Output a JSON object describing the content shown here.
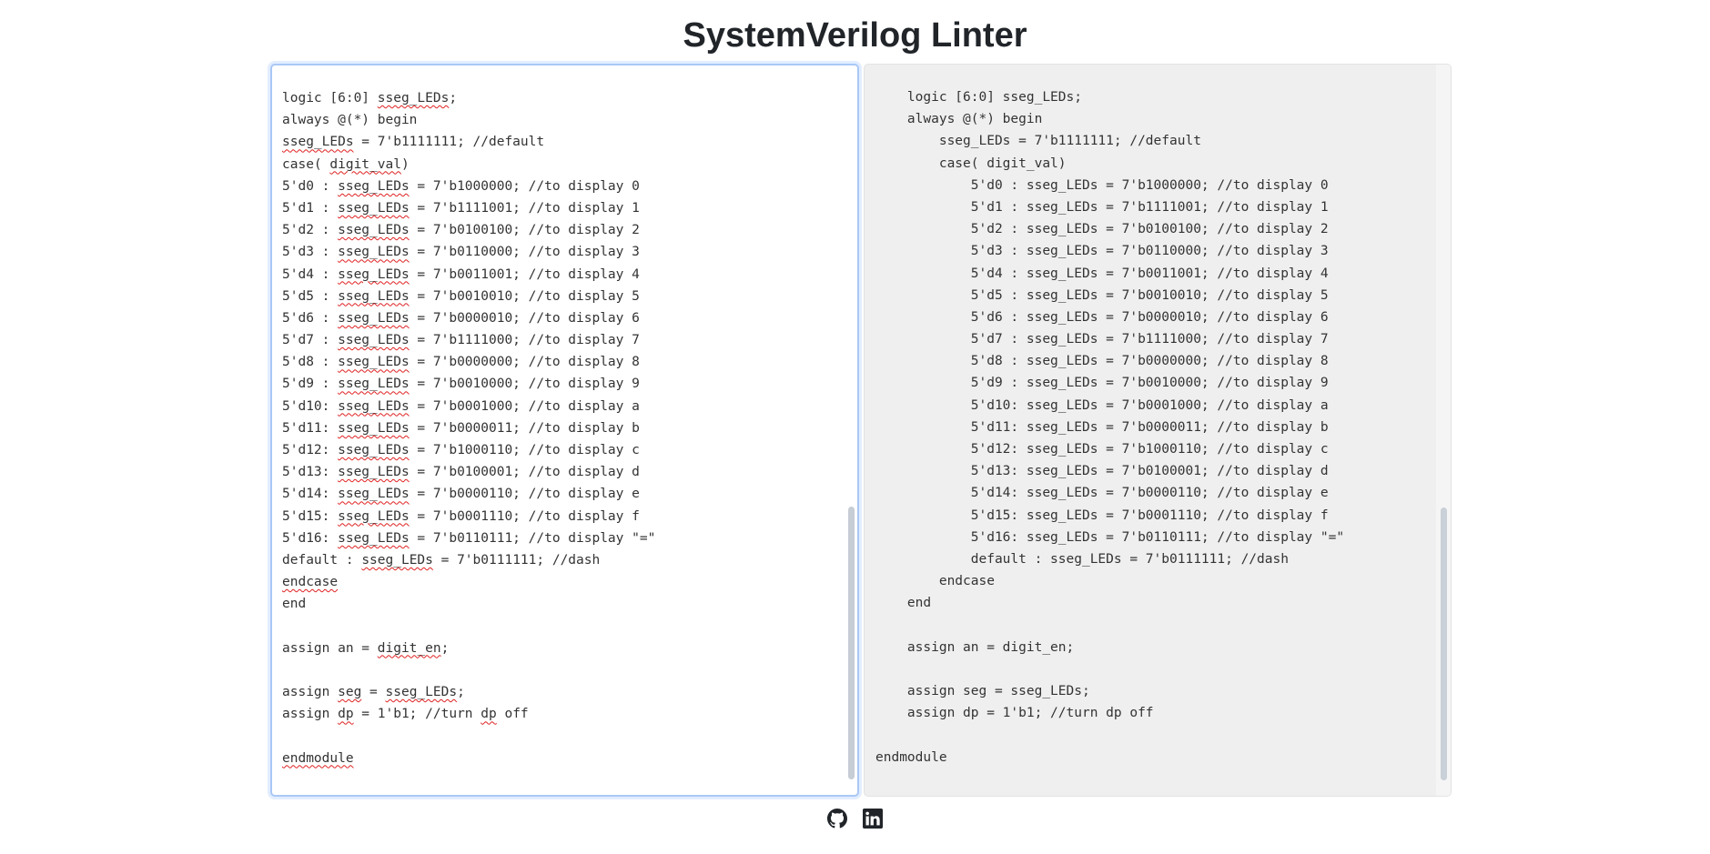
{
  "title": "SystemVerilog Linter",
  "input_lines": [
    [
      {
        "t": "logic [6:0] "
      },
      {
        "t": "sseg_LEDs",
        "s": 1
      },
      {
        "t": ";"
      }
    ],
    [
      {
        "t": "always @(*) begin"
      }
    ],
    [
      {
        "t": "sseg_LEDs",
        "s": 1
      },
      {
        "t": " = 7'b1111111; //default"
      }
    ],
    [
      {
        "t": "case( "
      },
      {
        "t": "digit_val",
        "s": 1
      },
      {
        "t": ")"
      }
    ],
    [
      {
        "t": "5'd0 : "
      },
      {
        "t": "sseg_LEDs",
        "s": 1
      },
      {
        "t": " = 7'b1000000; //to display 0"
      }
    ],
    [
      {
        "t": "5'd1 : "
      },
      {
        "t": "sseg_LEDs",
        "s": 1
      },
      {
        "t": " = 7'b1111001; //to display 1"
      }
    ],
    [
      {
        "t": "5'd2 : "
      },
      {
        "t": "sseg_LEDs",
        "s": 1
      },
      {
        "t": " = 7'b0100100; //to display 2"
      }
    ],
    [
      {
        "t": "5'd3 : "
      },
      {
        "t": "sseg_LEDs",
        "s": 1
      },
      {
        "t": " = 7'b0110000; //to display 3"
      }
    ],
    [
      {
        "t": "5'd4 : "
      },
      {
        "t": "sseg_LEDs",
        "s": 1
      },
      {
        "t": " = 7'b0011001; //to display 4"
      }
    ],
    [
      {
        "t": "5'd5 : "
      },
      {
        "t": "sseg_LEDs",
        "s": 1
      },
      {
        "t": " = 7'b0010010; //to display 5"
      }
    ],
    [
      {
        "t": "5'd6 : "
      },
      {
        "t": "sseg_LEDs",
        "s": 1
      },
      {
        "t": " = 7'b0000010; //to display 6"
      }
    ],
    [
      {
        "t": "5'd7 : "
      },
      {
        "t": "sseg_LEDs",
        "s": 1
      },
      {
        "t": " = 7'b1111000; //to display 7"
      }
    ],
    [
      {
        "t": "5'd8 : "
      },
      {
        "t": "sseg_LEDs",
        "s": 1
      },
      {
        "t": " = 7'b0000000; //to display 8"
      }
    ],
    [
      {
        "t": "5'd9 : "
      },
      {
        "t": "sseg_LEDs",
        "s": 1
      },
      {
        "t": " = 7'b0010000; //to display 9"
      }
    ],
    [
      {
        "t": "5'd10: "
      },
      {
        "t": "sseg_LEDs",
        "s": 1
      },
      {
        "t": " = 7'b0001000; //to display a"
      }
    ],
    [
      {
        "t": "5'd11: "
      },
      {
        "t": "sseg_LEDs",
        "s": 1
      },
      {
        "t": " = 7'b0000011; //to display b"
      }
    ],
    [
      {
        "t": "5'd12: "
      },
      {
        "t": "sseg_LEDs",
        "s": 1
      },
      {
        "t": " = 7'b1000110; //to display c"
      }
    ],
    [
      {
        "t": "5'd13: "
      },
      {
        "t": "sseg_LEDs",
        "s": 1
      },
      {
        "t": " = 7'b0100001; //to display d"
      }
    ],
    [
      {
        "t": "5'd14: "
      },
      {
        "t": "sseg_LEDs",
        "s": 1
      },
      {
        "t": " = 7'b0000110; //to display e"
      }
    ],
    [
      {
        "t": "5'd15: "
      },
      {
        "t": "sseg_LEDs",
        "s": 1
      },
      {
        "t": " = 7'b0001110; //to display f"
      }
    ],
    [
      {
        "t": "5'd16: "
      },
      {
        "t": "sseg_LEDs",
        "s": 1
      },
      {
        "t": " = 7'b0110111; //to display \"=\""
      }
    ],
    [
      {
        "t": "default : "
      },
      {
        "t": "sseg_LEDs",
        "s": 1
      },
      {
        "t": " = 7'b0111111; //dash"
      }
    ],
    [
      {
        "t": "endcase",
        "s": 1
      }
    ],
    [
      {
        "t": "end"
      }
    ],
    [
      {
        "t": ""
      }
    ],
    [
      {
        "t": "assign an = "
      },
      {
        "t": "digit_en",
        "s": 1
      },
      {
        "t": ";"
      }
    ],
    [
      {
        "t": ""
      }
    ],
    [
      {
        "t": "assign "
      },
      {
        "t": "seg",
        "s": 1
      },
      {
        "t": " = "
      },
      {
        "t": "sseg_LEDs",
        "s": 1
      },
      {
        "t": ";"
      }
    ],
    [
      {
        "t": "assign "
      },
      {
        "t": "dp",
        "s": 1
      },
      {
        "t": " = 1'b1; //turn "
      },
      {
        "t": "dp",
        "s": 1
      },
      {
        "t": " off"
      }
    ],
    [
      {
        "t": ""
      }
    ],
    [
      {
        "t": "endmodule",
        "s": 1
      }
    ]
  ],
  "output_lines": [
    "    logic [6:0] sseg_LEDs;",
    "    always @(*) begin",
    "        sseg_LEDs = 7'b1111111; //default",
    "        case( digit_val)",
    "            5'd0 : sseg_LEDs = 7'b1000000; //to display 0",
    "            5'd1 : sseg_LEDs = 7'b1111001; //to display 1",
    "            5'd2 : sseg_LEDs = 7'b0100100; //to display 2",
    "            5'd3 : sseg_LEDs = 7'b0110000; //to display 3",
    "            5'd4 : sseg_LEDs = 7'b0011001; //to display 4",
    "            5'd5 : sseg_LEDs = 7'b0010010; //to display 5",
    "            5'd6 : sseg_LEDs = 7'b0000010; //to display 6",
    "            5'd7 : sseg_LEDs = 7'b1111000; //to display 7",
    "            5'd8 : sseg_LEDs = 7'b0000000; //to display 8",
    "            5'd9 : sseg_LEDs = 7'b0010000; //to display 9",
    "            5'd10: sseg_LEDs = 7'b0001000; //to display a",
    "            5'd11: sseg_LEDs = 7'b0000011; //to display b",
    "            5'd12: sseg_LEDs = 7'b1000110; //to display c",
    "            5'd13: sseg_LEDs = 7'b0100001; //to display d",
    "            5'd14: sseg_LEDs = 7'b0000110; //to display e",
    "            5'd15: sseg_LEDs = 7'b0001110; //to display f",
    "            5'd16: sseg_LEDs = 7'b0110111; //to display \"=\"",
    "            default : sseg_LEDs = 7'b0111111; //dash",
    "        endcase",
    "    end",
    "",
    "    assign an = digit_en;",
    "",
    "    assign seg = sseg_LEDs;",
    "    assign dp = 1'b1; //turn dp off",
    "",
    "endmodule"
  ],
  "footer": {
    "icons": [
      "github-icon",
      "linkedin-icon"
    ]
  },
  "colors": {
    "focus_border": "#a9c8f5",
    "output_bg": "#efefef",
    "spellcheck": "#e02020"
  }
}
